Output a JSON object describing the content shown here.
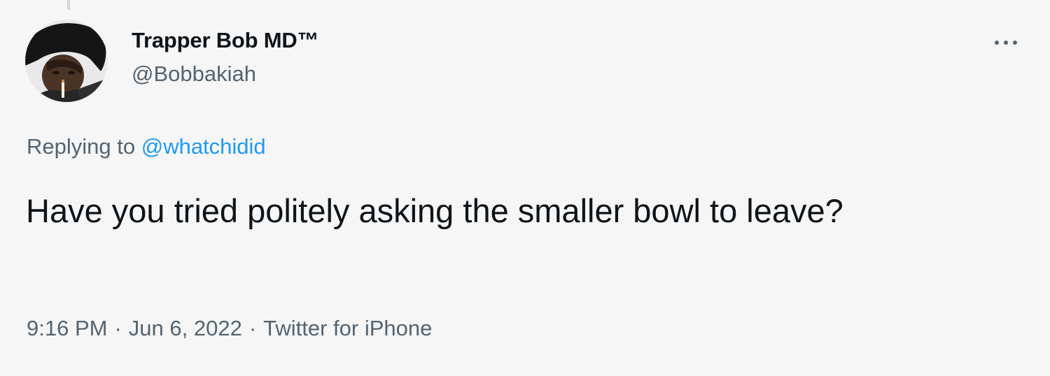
{
  "tweet": {
    "author": {
      "display_name": "Trapper Bob MD™",
      "handle": "@Bobbakiah"
    },
    "reply_context": {
      "prefix": "Replying to",
      "mention": "@whatchidid"
    },
    "text": "Have you tried politely asking the smaller bowl to leave?",
    "time": "9:16 PM",
    "separator": "·",
    "date": "Jun 6, 2022",
    "source": "Twitter for iPhone"
  },
  "icons": {
    "more": "more-horizontal-icon"
  },
  "colors": {
    "background": "#f6f6f6",
    "text_primary": "#0f1419",
    "text_secondary": "#536471",
    "link": "#1d9bf0"
  }
}
